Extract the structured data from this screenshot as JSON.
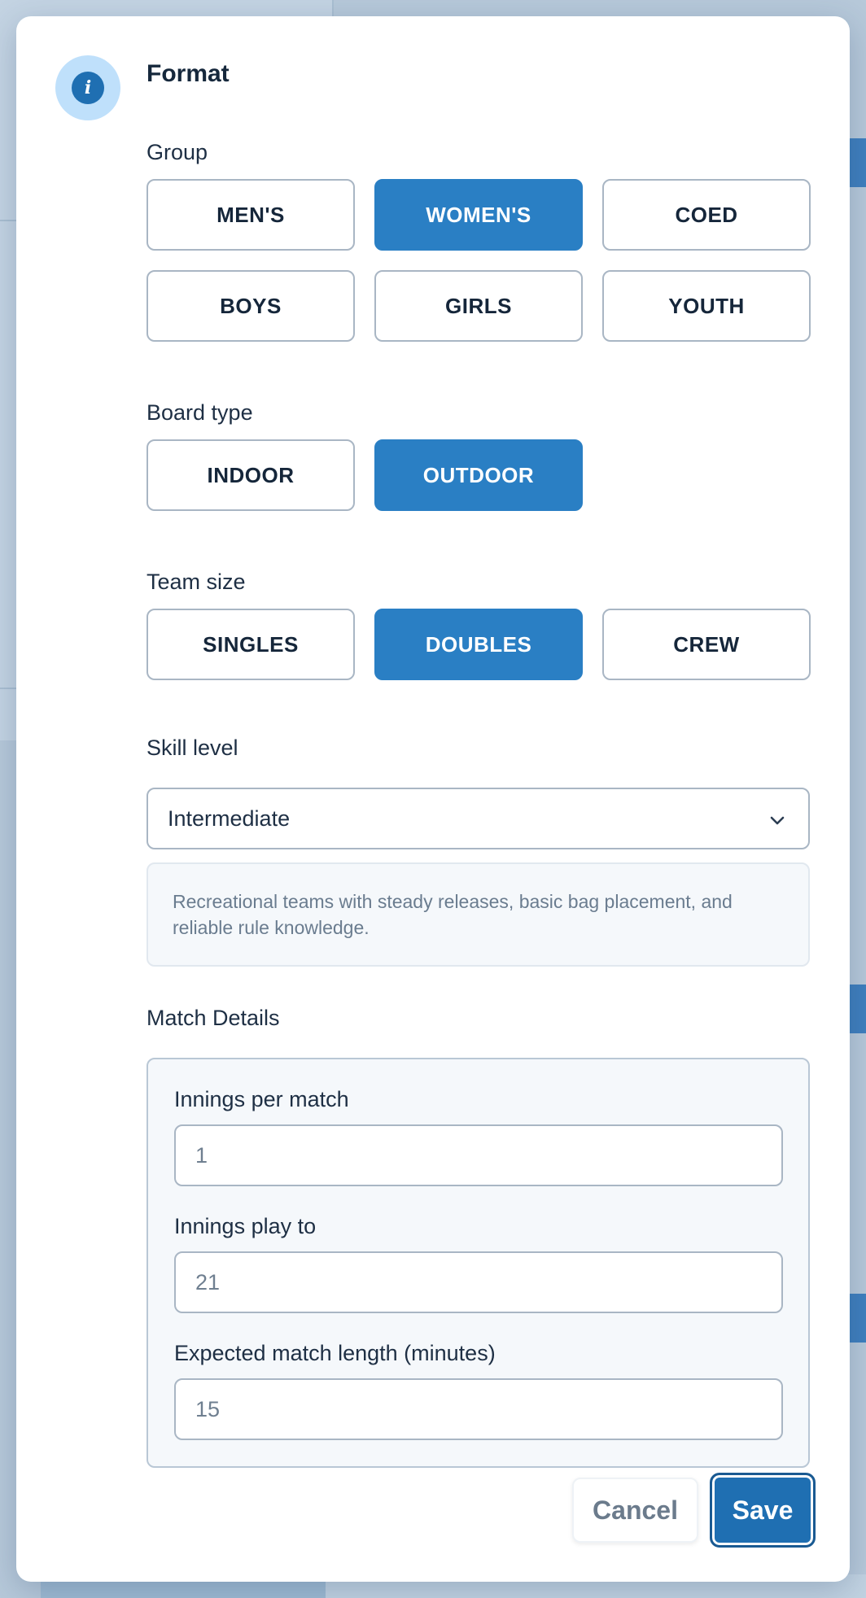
{
  "dialog": {
    "title": "Format",
    "icon": "info-icon",
    "icon_glyph": "i"
  },
  "group": {
    "label": "Group",
    "options": [
      "MEN'S",
      "WOMEN'S",
      "COED",
      "BOYS",
      "GIRLS",
      "YOUTH"
    ],
    "selected": "WOMEN'S"
  },
  "board_type": {
    "label": "Board type",
    "options": [
      "INDOOR",
      "OUTDOOR"
    ],
    "selected": "OUTDOOR"
  },
  "team_size": {
    "label": "Team size",
    "options": [
      "SINGLES",
      "DOUBLES",
      "CREW"
    ],
    "selected": "DOUBLES"
  },
  "skill_level": {
    "label": "Skill level",
    "selected": "Intermediate",
    "description": "Recreational teams with steady releases, basic bag placement, and reliable rule knowledge."
  },
  "match_details": {
    "label": "Match Details",
    "innings_per_match": {
      "label": "Innings per match",
      "value": "1"
    },
    "innings_play_to": {
      "label": "Innings play to",
      "value": "21"
    },
    "expected_length": {
      "label": "Expected match length (minutes)",
      "value": "15"
    }
  },
  "actions": {
    "cancel_label": "Cancel",
    "save_label": "Save"
  },
  "colors": {
    "accent": "#2a7fc4",
    "save": "#1f6fb2",
    "badge_bg": "#bfe0fb"
  }
}
